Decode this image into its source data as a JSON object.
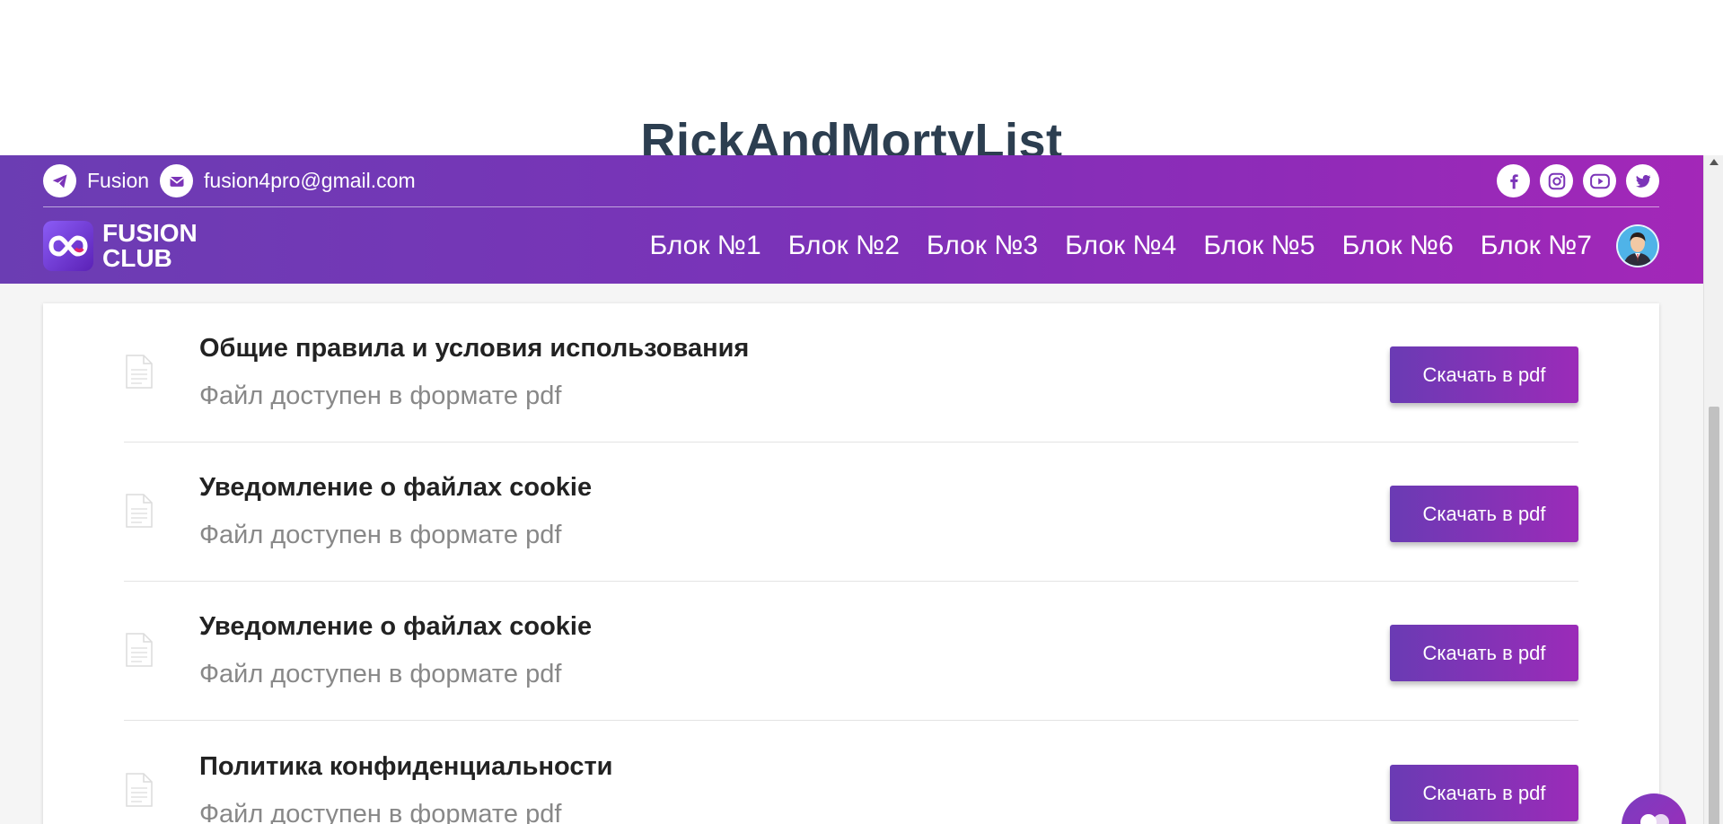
{
  "page": {
    "title": "RickAndMortyList"
  },
  "header": {
    "telegram_label": "Fusion",
    "email": "fusion4pro@gmail.com",
    "socials": [
      "facebook-icon",
      "instagram-icon",
      "youtube-icon",
      "twitter-icon"
    ],
    "logo_line1": "FUSION",
    "logo_line2": "CLUB",
    "nav": [
      "Блок №1",
      "Блок №2",
      "Блок №3",
      "Блок №4",
      "Блок №5",
      "Блок №6",
      "Блок №7"
    ]
  },
  "documents": [
    {
      "title": "Общие правила и условия использования",
      "subtitle": "Файл доступен в формате pdf",
      "button": "Скачать в pdf"
    },
    {
      "title": "Уведомление о файлах cookie",
      "subtitle": "Файл доступен в формате pdf",
      "button": "Скачать в pdf"
    },
    {
      "title": "Уведомление о файлах cookie",
      "subtitle": "Файл доступен в формате pdf",
      "button": "Скачать в pdf"
    },
    {
      "title": "Политика конфиденциальности",
      "subtitle": "Файл доступен в формате pdf",
      "button": "Скачать в pdf"
    }
  ],
  "colors": {
    "header_start": "#6b3db3",
    "header_end": "#a327b8",
    "accent": "#7b34b8"
  }
}
